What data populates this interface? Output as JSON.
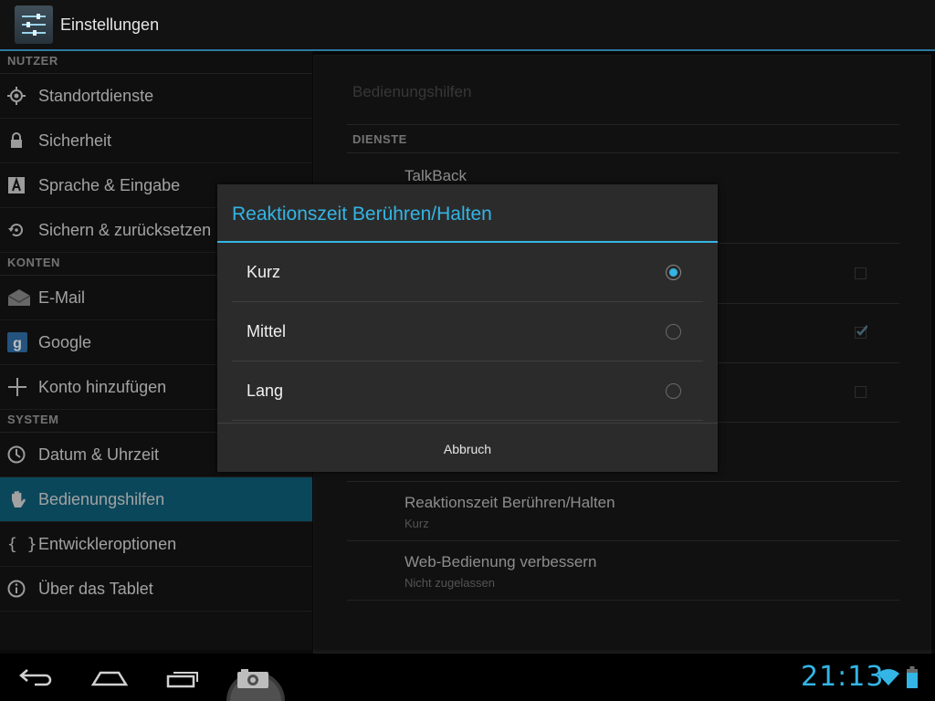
{
  "app": {
    "title": "Einstellungen"
  },
  "sidebar": {
    "sections": [
      {
        "header": "NUTZER",
        "items": [
          {
            "label": "Standortdienste",
            "icon": "location-icon"
          },
          {
            "label": "Sicherheit",
            "icon": "lock-icon"
          },
          {
            "label": "Sprache & Eingabe",
            "icon": "language-icon"
          },
          {
            "label": "Sichern & zurücksetzen",
            "icon": "backup-icon"
          }
        ]
      },
      {
        "header": "KONTEN",
        "items": [
          {
            "label": "E-Mail",
            "icon": "email-icon"
          },
          {
            "label": "Google",
            "icon": "google-icon"
          },
          {
            "label": "Konto hinzufügen",
            "icon": "plus-icon"
          }
        ]
      },
      {
        "header": "SYSTEM",
        "items": [
          {
            "label": "Datum & Uhrzeit",
            "icon": "clock-icon"
          },
          {
            "label": "Bedienungshilfen",
            "icon": "hand-icon",
            "active": true
          },
          {
            "label": "Entwickleroptionen",
            "icon": "braces-icon"
          },
          {
            "label": "Über das Tablet",
            "icon": "info-icon"
          }
        ]
      }
    ]
  },
  "detail": {
    "title": "Bedienungshilfen",
    "section": "DIENSTE",
    "talkback": "TalkBack",
    "touch_delay": {
      "title": "Reaktionszeit Berühren/Halten",
      "summary": "Kurz"
    },
    "web_access": {
      "title": "Web-Bedienung verbessern",
      "summary": "Nicht zugelassen"
    },
    "checkboxes": [
      false,
      true,
      false
    ]
  },
  "dialog": {
    "title": "Reaktionszeit Berühren/Halten",
    "options": [
      {
        "label": "Kurz",
        "selected": true
      },
      {
        "label": "Mittel",
        "selected": false
      },
      {
        "label": "Lang",
        "selected": false
      }
    ],
    "cancel": "Abbruch"
  },
  "status": {
    "time": "21:13"
  },
  "colors": {
    "accent": "#33b5e5",
    "active_item": "#0f5f7a"
  }
}
